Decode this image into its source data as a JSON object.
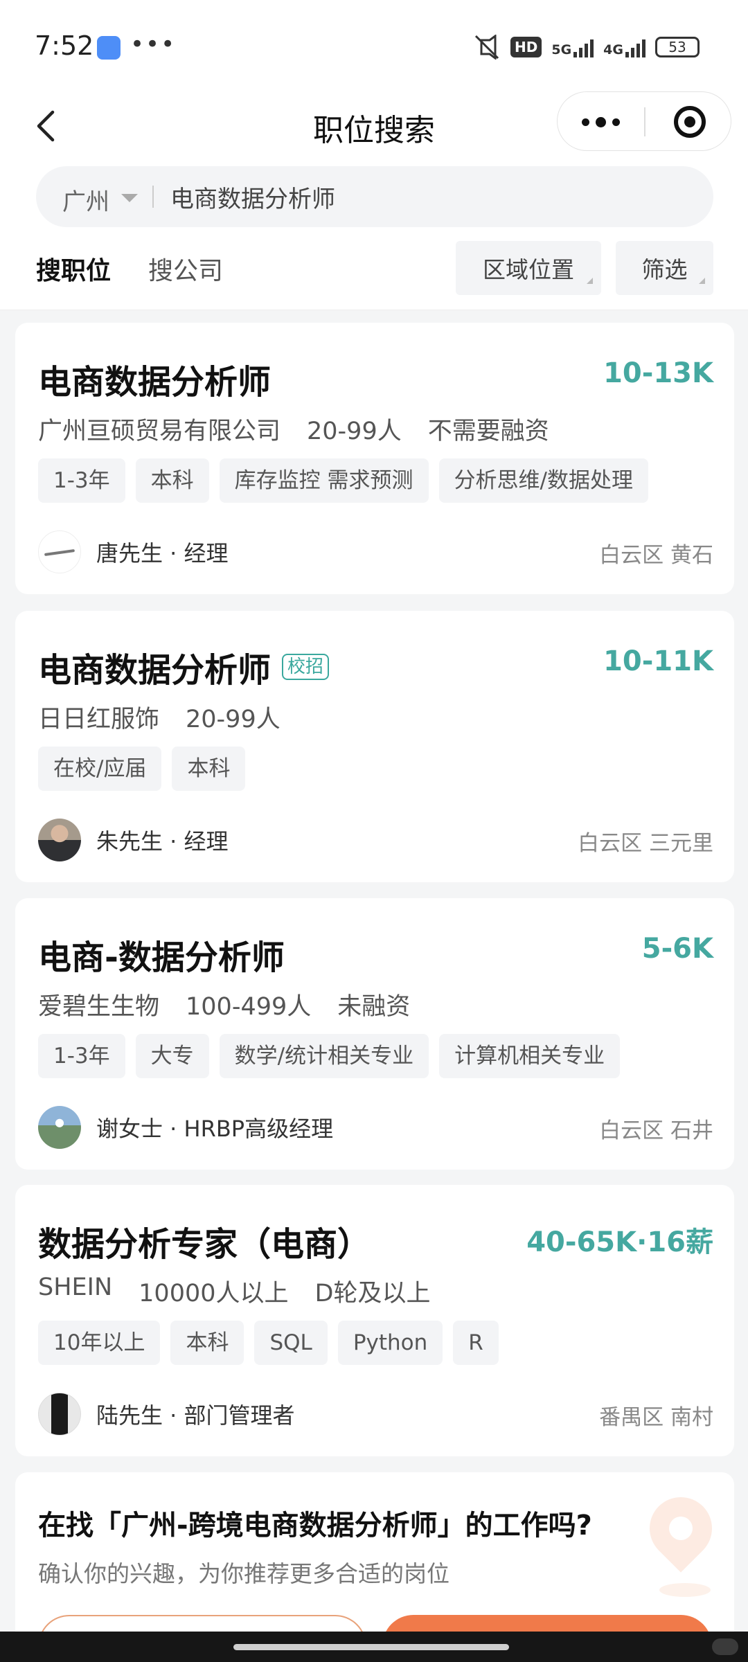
{
  "status_bar": {
    "time": "7:52",
    "dots": "•••",
    "hd_label": "HD",
    "net1": "5G",
    "net2": "4G",
    "battery": "53"
  },
  "nav": {
    "title": "职位搜索"
  },
  "search": {
    "city": "广州",
    "query": "电商数据分析师"
  },
  "tabs": {
    "active": "搜职位",
    "inactive": "搜公司",
    "filter_region": "区域位置",
    "filter_more": "筛选"
  },
  "jobs": [
    {
      "title": "电商数据分析师",
      "salary": "10-13K",
      "company": "广州亘硕贸易有限公司",
      "size": "20-99人",
      "funding": "不需要融资",
      "tags": [
        "1-3年",
        "本科",
        "库存监控 需求预测",
        "分析思维/数据处理"
      ],
      "recruiter": "唐先生 · 经理",
      "location": "白云区 黄石"
    },
    {
      "title": "电商数据分析师",
      "badge": "校招",
      "salary": "10-11K",
      "company": "日日红服饰",
      "size": "20-99人",
      "tags": [
        "在校/应届",
        "本科"
      ],
      "recruiter": "朱先生 · 经理",
      "location": "白云区 三元里"
    },
    {
      "title": "电商-数据分析师",
      "salary": "5-6K",
      "company": "爱碧生生物",
      "size": "100-499人",
      "funding": "未融资",
      "tags": [
        "1-3年",
        "大专",
        "数学/统计相关专业",
        "计算机相关专业"
      ],
      "recruiter": "谢女士 · HRBP高级经理",
      "location": "白云区 石井"
    },
    {
      "title": "数据分析专家（电商）",
      "salary": "40-65K·16薪",
      "company": "SHEIN",
      "size": "10000人以上",
      "funding": "D轮及以上",
      "tags": [
        "10年以上",
        "本科",
        "SQL",
        "Python",
        "R"
      ],
      "recruiter": "陆先生 · 部门管理者",
      "location": "番禺区 南村"
    }
  ],
  "promo": {
    "title": "在找「广州-跨境电商数据分析师」的工作吗?",
    "subtitle": "确认你的兴趣，为你推荐更多合适的岗位"
  },
  "colors": {
    "salary": "#45a8a0",
    "accent": "#f07a4a"
  }
}
